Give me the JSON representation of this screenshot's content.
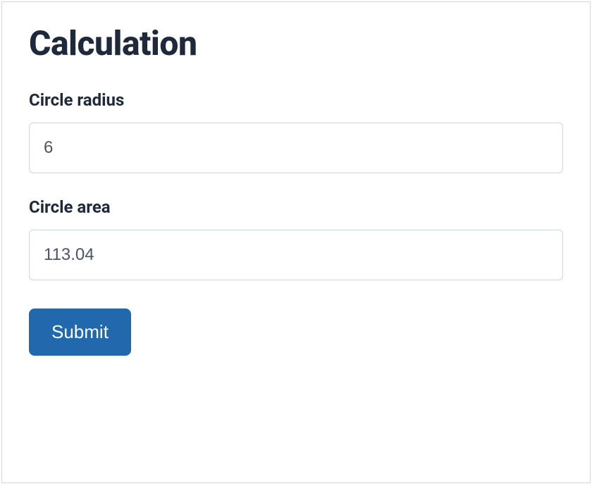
{
  "title": "Calculation",
  "form": {
    "radius": {
      "label": "Circle radius",
      "value": "6"
    },
    "area": {
      "label": "Circle area",
      "value": "113.04"
    },
    "submit_label": "Submit"
  }
}
